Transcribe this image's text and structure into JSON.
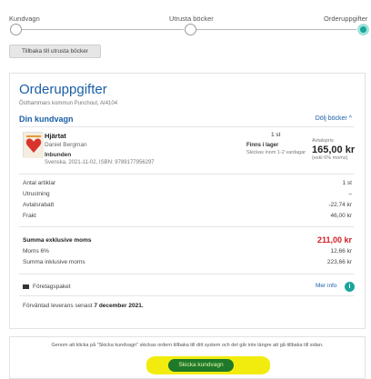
{
  "steps": [
    {
      "label": "Kundvagn",
      "active": false
    },
    {
      "label": "Utrusta böcker",
      "active": false
    },
    {
      "label": "Orderuppgifter",
      "active": true
    }
  ],
  "back_button": "Tillbaka till utrusta böcker",
  "order": {
    "title": "Orderuppgifter",
    "subtitle": "Östhammars kommun Punchout, AI4104",
    "cart_title": "Din kundvagn",
    "toggle_label": "Dölj böcker ^"
  },
  "item": {
    "title": "Hjärtat",
    "author": "Daniel Bergman",
    "format": "Inbunden",
    "meta": "Svenska, 2021-11-02, ISBN: 9789177956297",
    "quantity": "1 st",
    "stock": "Finns i lager",
    "shipping": "Skickas inom 1-2 vardagar",
    "price_label": "Avtalspris",
    "price": "165,00 kr",
    "price_note": "(exkl 6% moms)"
  },
  "summary": {
    "rows1": [
      {
        "label": "Antal artiklar",
        "value": "1 st"
      },
      {
        "label": "Utrustning",
        "value": "–"
      },
      {
        "label": "Avtalsrabatt",
        "value": "-22,74 kr"
      },
      {
        "label": "Frakt",
        "value": "46,00 kr"
      }
    ],
    "total_ex_label": "Summa exklusive moms",
    "total_ex_value": "211,00 kr",
    "vat_label": "Moms 6%",
    "vat_value": "12,66 kr",
    "total_inc_label": "Summa inklusive moms",
    "total_inc_value": "223,66 kr"
  },
  "package": {
    "label": "Företagspaket",
    "more_info": "Mer info",
    "info_icon": "i"
  },
  "delivery": {
    "text": "Förväntad leverans senast ",
    "date": "7 december 2021."
  },
  "footer": {
    "notice": "Genom att klicka på \"Skicka kundvagn\" skickas ordern tillbaka till ditt system och det går inte längre att gå tillbaka till sidan.",
    "submit": "Skicka kundvagn",
    "highlight_color": "#f2ec0e",
    "accent": "#18a59a"
  }
}
